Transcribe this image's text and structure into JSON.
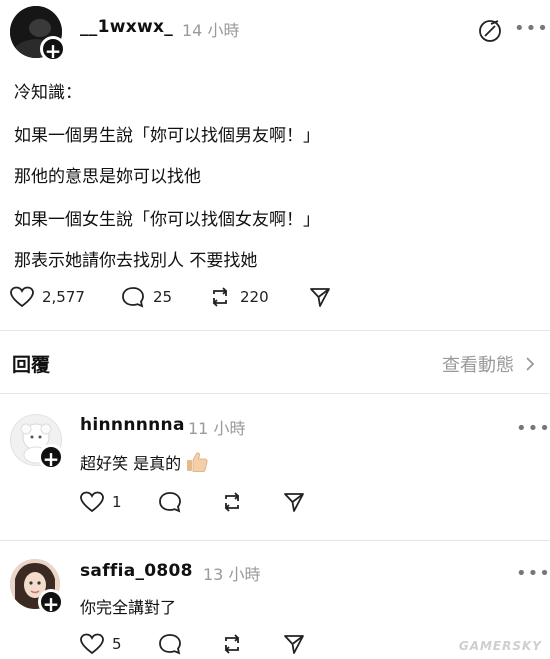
{
  "post": {
    "username": "__1wxwx_",
    "time": "14 小時",
    "lines": [
      "冷知識：",
      "如果一個男生說「妳可以找個男友啊！」",
      "那他的意思是妳可以找他",
      "如果一個女生說「你可以找個女友啊！」",
      "那表示她請你去找別人 不要找她"
    ],
    "likes": "2,577",
    "comments": "25",
    "reposts": "220"
  },
  "replies_header": {
    "title": "回覆",
    "activity_link": "查看動態"
  },
  "comments": [
    {
      "username": "hinnnnnna",
      "time": "11 小時",
      "text": "超好笑 是真的",
      "likes": "1"
    },
    {
      "username": "saffia_0808",
      "time": "13 小時",
      "text": "你完全講對了",
      "likes": "5"
    }
  ],
  "watermark": "GAMERSKY",
  "colors": {
    "text": "#111111",
    "secondary": "#9a9a9a",
    "divider": "#e6e6e6"
  }
}
